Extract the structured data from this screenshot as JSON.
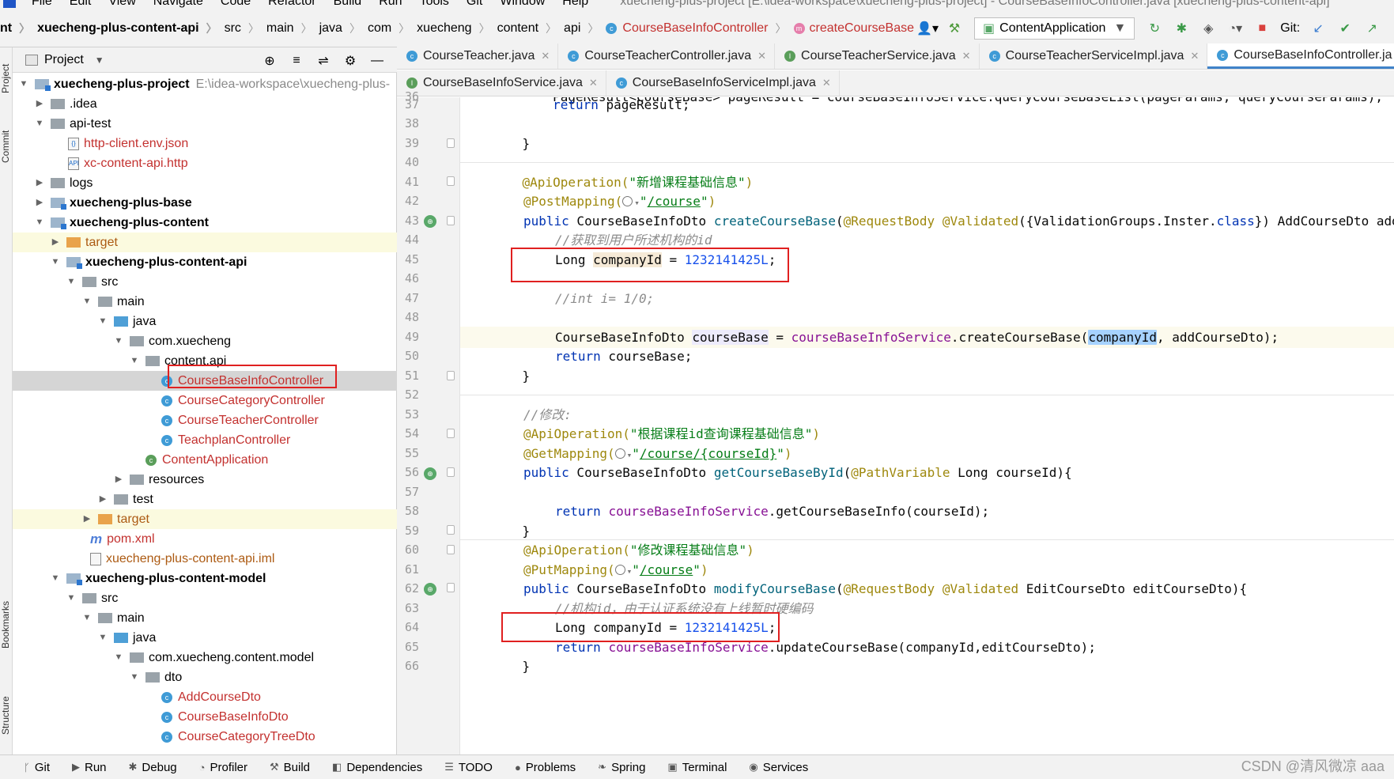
{
  "menu": [
    "File",
    "Edit",
    "View",
    "Navigate",
    "Code",
    "Refactor",
    "Build",
    "Run",
    "Tools",
    "Git",
    "Window",
    "Help"
  ],
  "window_title": "xuecheng-plus-project [E:\\idea-workspace\\xuecheng-plus-project] - CourseBaseInfoController.java [xuecheng-plus-content-api]",
  "breadcrumb": [
    "nt",
    "xuecheng-plus-content-api",
    "src",
    "main",
    "java",
    "com",
    "xuecheng",
    "content",
    "api",
    "CourseBaseInfoController",
    "createCourseBase"
  ],
  "run_config": "ContentApplication",
  "git_label": "Git:",
  "side_labels": {
    "project": "Project",
    "commit": "Commit",
    "bookmarks": "Bookmarks",
    "structure": "Structure"
  },
  "project_panel": {
    "title": "Project"
  },
  "tree": [
    {
      "label": "xuecheng-plus-project",
      "path": "E:\\idea-workspace\\xuecheng-plus-"
    },
    {
      "label": ".idea"
    },
    {
      "label": "api-test"
    },
    {
      "label": "http-client.env.json"
    },
    {
      "label": "xc-content-api.http"
    },
    {
      "label": "logs"
    },
    {
      "label": "xuecheng-plus-base"
    },
    {
      "label": "xuecheng-plus-content"
    },
    {
      "label": "target"
    },
    {
      "label": "xuecheng-plus-content-api"
    },
    {
      "label": "src"
    },
    {
      "label": "main"
    },
    {
      "label": "java"
    },
    {
      "label": "com.xuecheng"
    },
    {
      "label": "content.api"
    },
    {
      "label": "CourseBaseInfoController"
    },
    {
      "label": "CourseCategoryController"
    },
    {
      "label": "CourseTeacherController"
    },
    {
      "label": "TeachplanController"
    },
    {
      "label": "ContentApplication"
    },
    {
      "label": "resources"
    },
    {
      "label": "test"
    },
    {
      "label": "target"
    },
    {
      "label": "pom.xml"
    },
    {
      "label": "xuecheng-plus-content-api.iml"
    },
    {
      "label": "xuecheng-plus-content-model"
    },
    {
      "label": "src"
    },
    {
      "label": "main"
    },
    {
      "label": "java"
    },
    {
      "label": "com.xuecheng.content.model"
    },
    {
      "label": "dto"
    },
    {
      "label": "AddCourseDto"
    },
    {
      "label": "CourseBaseInfoDto"
    },
    {
      "label": "CourseCategoryTreeDto"
    }
  ],
  "tabs_row1": [
    "CourseTeacher.java",
    "CourseTeacherController.java",
    "CourseTeacherService.java",
    "CourseTeacherServiceImpl.java",
    "CourseBaseInfoController.ja"
  ],
  "tabs_row2": [
    "CourseBaseInfoService.java",
    "CourseBaseInfoServiceImpl.java"
  ],
  "line_numbers": [
    "36",
    "37",
    "38",
    "39",
    "40",
    "41",
    "42",
    "43",
    "44",
    "45",
    "46",
    "47",
    "48",
    "49",
    "50",
    "51",
    "52",
    "53",
    "54",
    "55",
    "56",
    "57",
    "58",
    "59",
    "60",
    "61",
    "62",
    "63",
    "64",
    "65",
    "66"
  ],
  "code": {
    "l36": "        PageResult<CourseBase> pageResult = courseBaseInfoService.queryCourseBaseList(pageParams, queryCourseParams);",
    "l37_a": "        ",
    "l37_k": "return",
    "l37_b": " pageResult;",
    "l39": "    }",
    "l41_a": "    ",
    "l41_ann": "@ApiOperation(",
    "l41_str": "\"新增课程基础信息\"",
    "l41_end": ")",
    "l42_ann": "@PostMapping(",
    "l42_q1": "\"",
    "l42_path": "/course",
    "l42_q2": "\"",
    "l42_end": ")",
    "l43_k": "public",
    "l43_t": " CourseBaseInfoDto ",
    "l43_m": "createCourseBase",
    "l43_p": "(",
    "l43_a1": "@RequestBody",
    "l43_s": " ",
    "l43_a2": "@Validated",
    "l43_r1": "({ValidationGroups.Inster.",
    "l43_k2": "class",
    "l43_r2": "}) AddCourseDto addCourseDto){",
    "l44": "//获取到用户所述机构的id",
    "l45_t": "Long ",
    "l45_v": "companyId",
    "l45_e": " = ",
    "l45_n": "1232141425L",
    "l45_s": ";",
    "l47": "//int i= 1/0;",
    "l49_t": "CourseBaseInfoDto ",
    "l49_v": "courseBase",
    "l49_e": " = ",
    "l49_f": "courseBaseInfoService",
    "l49_c": ".createCourseBase(",
    "l49_sel": "companyId",
    "l49_r": ", addCourseDto);",
    "l50_k": "return",
    "l50_r": " courseBase;",
    "l51": "    }",
    "l53": "//修改:",
    "l54_ann": "@ApiOperation(",
    "l54_str": "\"根据课程id查询课程基础信息\"",
    "l54_end": ")",
    "l55_ann": "@GetMapping(",
    "l55_q1": "\"",
    "l55_path": "/course/{courseId}",
    "l55_q2": "\"",
    "l55_end": ")",
    "l56_k": "public",
    "l56_t": " CourseBaseInfoDto ",
    "l56_m": "getCourseBaseById",
    "l56_p": "(",
    "l56_a": "@PathVariable",
    "l56_r": " Long courseId){",
    "l58_k": "return",
    "l58_s": " ",
    "l58_f": "courseBaseInfoService",
    "l58_r": ".getCourseBaseInfo(courseId);",
    "l59": "    }",
    "l60_ann": "@ApiOperation(",
    "l60_str": "\"修改课程基础信息\"",
    "l60_end": ")",
    "l61_ann": "@PutMapping(",
    "l61_q1": "\"",
    "l61_path": "/course",
    "l61_q2": "\"",
    "l61_end": ")",
    "l62_k": "public",
    "l62_t": " CourseBaseInfoDto ",
    "l62_m": "modifyCourseBase",
    "l62_p": "(",
    "l62_a1": "@RequestBody",
    "l62_s": " ",
    "l62_a2": "@Validated",
    "l62_r": " EditCourseDto editCourseDto){",
    "l63": "//机构id，由于认证系统没有上线暂时硬编码",
    "l64_t": "Long companyId = ",
    "l64_n": "1232141425L",
    "l64_s": ";",
    "l65_k": "return",
    "l65_s": " ",
    "l65_f": "courseBaseInfoService",
    "l65_r": ".updateCourseBase(companyId,editCourseDto);",
    "l66": "    }"
  },
  "bottom_tools": [
    "Git",
    "Run",
    "Debug",
    "Profiler",
    "Build",
    "Dependencies",
    "TODO",
    "Problems",
    "Spring",
    "Terminal",
    "Services"
  ],
  "watermark": "CSDN @清风微凉 aaa"
}
